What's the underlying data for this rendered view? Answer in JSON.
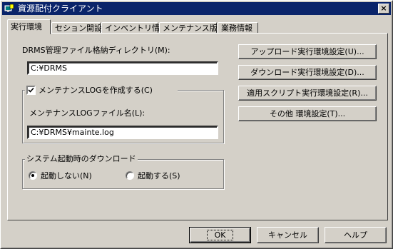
{
  "window": {
    "title": "資源配付クライアント",
    "close_label": "×"
  },
  "tabs": [
    {
      "label": "実行環境",
      "active": true
    },
    {
      "label": "セション開設",
      "active": false
    },
    {
      "label": "インベントリ情報",
      "active": false
    },
    {
      "label": "メンテナンス版数",
      "active": false
    },
    {
      "label": "業務情報",
      "active": false
    }
  ],
  "drms_dir": {
    "label": "DRMS管理ファイル格納ディレクトリ(M):",
    "value": "C:¥DRMS"
  },
  "maintenance_log": {
    "checkbox_label": "メンテナンスLOGを作成する(C)",
    "checked": true,
    "file_label": "メンテナンスLOGファイル名(L):",
    "file_value": "C:¥DRMS¥mainte.log"
  },
  "startup_download": {
    "group_label": "システム起動時のダウンロード",
    "option_no": "起動しない(N)",
    "option_yes": "起動する(S)",
    "selected": "no"
  },
  "settings_buttons": {
    "upload": "アップロード実行環境設定(U)...",
    "download": "ダウンロード実行環境設定(D)...",
    "script": "適用スクリプト実行環境設定(R)...",
    "other": "その他 環境設定(T)..."
  },
  "footer": {
    "ok": "OK",
    "cancel": "キャンセル",
    "help": "ヘルプ"
  }
}
